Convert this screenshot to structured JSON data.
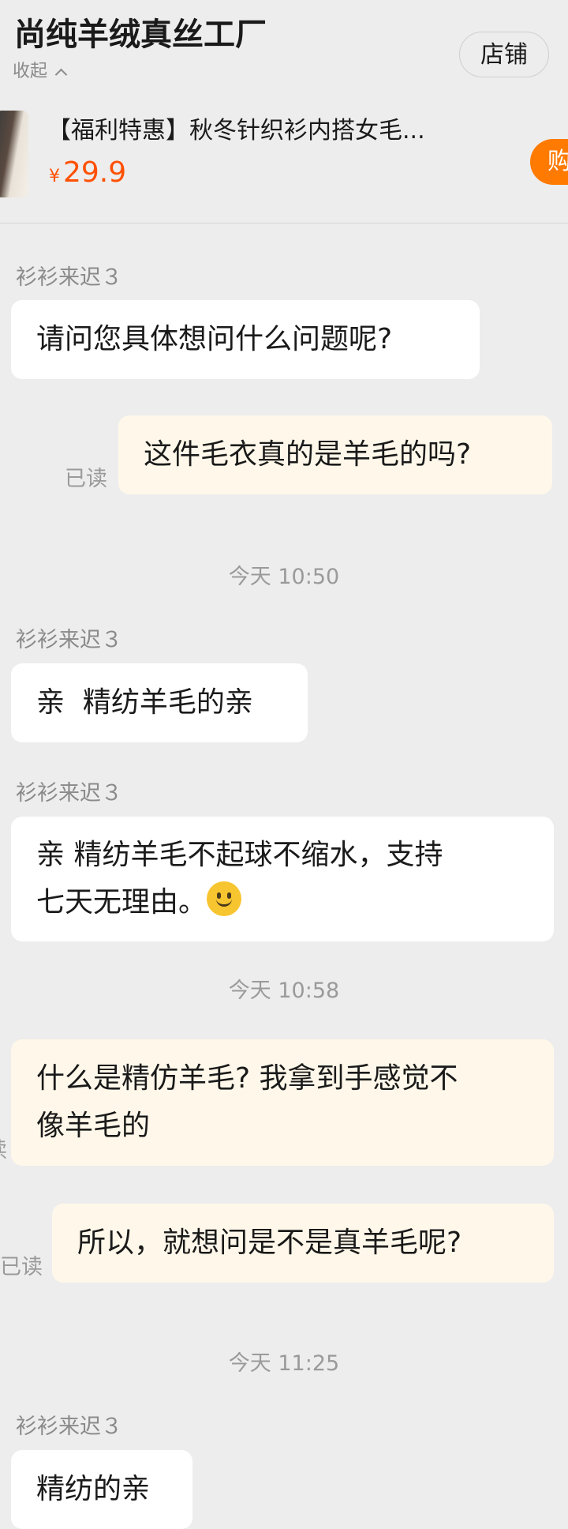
{
  "header": {
    "shop_name": "尚纯羊绒真丝工厂",
    "collapse_label": "收起",
    "store_button": "店铺"
  },
  "product": {
    "title": "【福利特惠】秋冬针织衫内搭女毛...",
    "currency": "¥",
    "price": "29.9",
    "buy_button": "购"
  },
  "messages": [
    {
      "sender": "衫衫来迟３",
      "text": "请问您具体想问什么问题呢?"
    },
    {
      "text": "这件毛衣真的是羊毛的吗?",
      "status": "已读"
    },
    {
      "time": "今天 10:50"
    },
    {
      "sender": "衫衫来迟３",
      "text": "亲  精纺羊毛的亲"
    },
    {
      "sender": "衫衫来迟３",
      "line1": "亲 精纺羊毛不起球不缩水，支持",
      "line2": "七天无理由。",
      "emoji": "slightly-smiling-face-icon"
    },
    {
      "time": "今天 10:58"
    },
    {
      "line1": "什么是精仿羊毛? 我拿到手感觉不",
      "line2": "像羊毛的",
      "status": "读"
    },
    {
      "text": "所以，就想问是不是真羊毛呢?",
      "status": "已读"
    },
    {
      "time": "今天 11:25"
    },
    {
      "sender": "衫衫来迟３",
      "text": "精纺的亲"
    }
  ],
  "colors": {
    "background": "#EDEDED",
    "incoming_bubble": "#FFFFFF",
    "outgoing_bubble": "#FFF8EA",
    "price": "#FF5000",
    "buy_button": "#FF7A00",
    "muted_text": "#8A8A8A"
  }
}
